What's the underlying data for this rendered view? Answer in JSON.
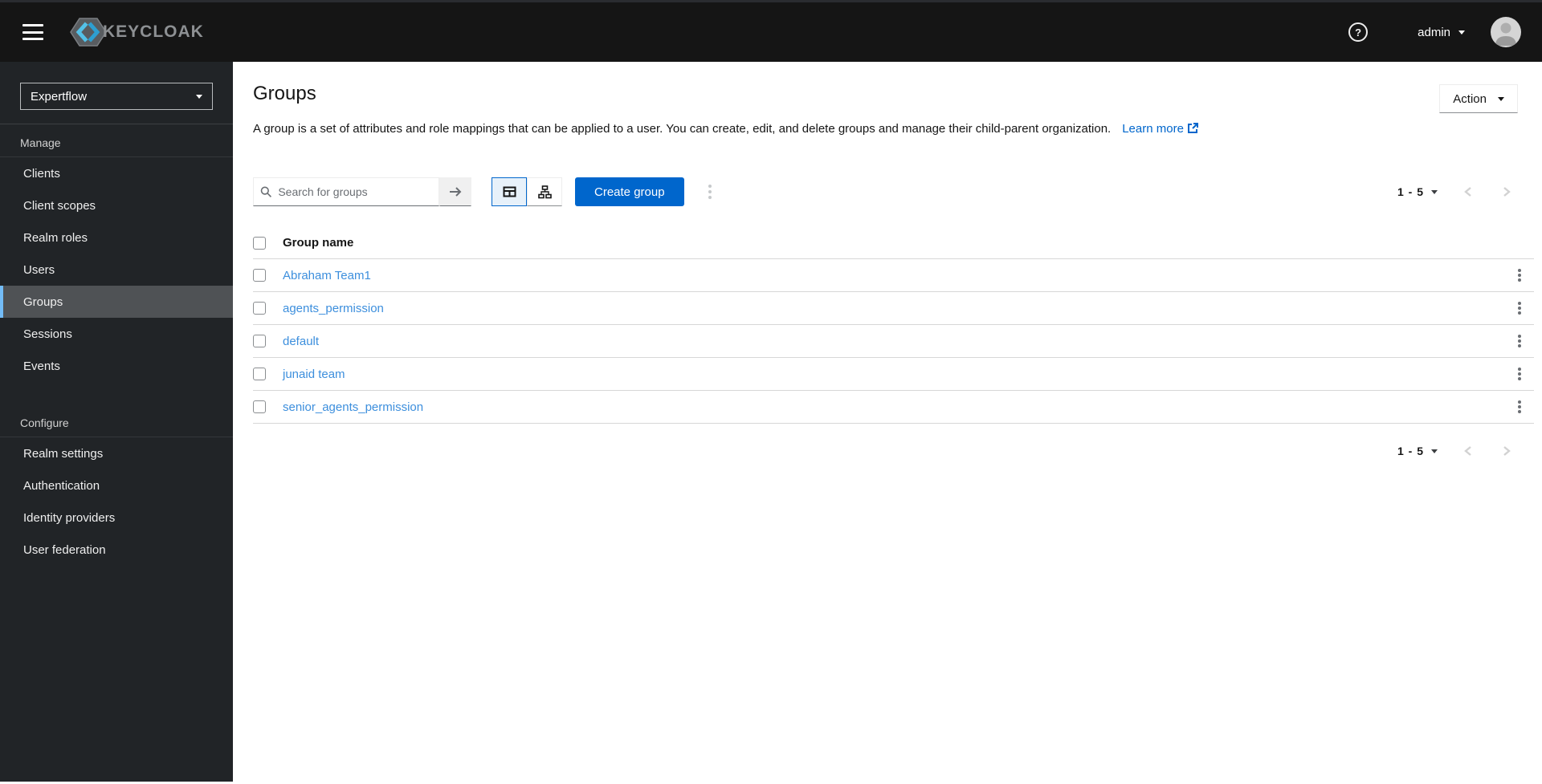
{
  "masthead": {
    "brand": "KEYCLOAK",
    "username": "admin",
    "help_label": "?"
  },
  "sidebar": {
    "realm": "Expertflow",
    "manage": {
      "label": "Manage",
      "items": [
        {
          "label": "Clients"
        },
        {
          "label": "Client scopes"
        },
        {
          "label": "Realm roles"
        },
        {
          "label": "Users"
        },
        {
          "label": "Groups",
          "active": true
        },
        {
          "label": "Sessions"
        },
        {
          "label": "Events"
        }
      ]
    },
    "configure": {
      "label": "Configure",
      "items": [
        {
          "label": "Realm settings"
        },
        {
          "label": "Authentication"
        },
        {
          "label": "Identity providers"
        },
        {
          "label": "User federation"
        }
      ]
    }
  },
  "page": {
    "title": "Groups",
    "description": "A group is a set of attributes and role mappings that can be applied to a user. You can create, edit, and delete groups and manage their child-parent organization.",
    "learn_more": "Learn more",
    "action_label": "Action"
  },
  "toolbar": {
    "search_placeholder": "Search for groups",
    "create_label": "Create group"
  },
  "pagination": {
    "range": "1 - 5"
  },
  "table": {
    "name_header": "Group name",
    "rows": [
      {
        "name": "Abraham Team1"
      },
      {
        "name": "agents_permission"
      },
      {
        "name": "default"
      },
      {
        "name": "junaid team"
      },
      {
        "name": "senior_agents_permission"
      }
    ]
  },
  "colors": {
    "accent": "#0066cc",
    "row_link": "#3d8fdd",
    "masthead_bg": "#151515",
    "sidebar_bg": "#212427",
    "nav_active_bg": "#4f5255",
    "nav_active_accent": "#73bcf7",
    "toggle_selected_bg": "#e7f1fa"
  }
}
